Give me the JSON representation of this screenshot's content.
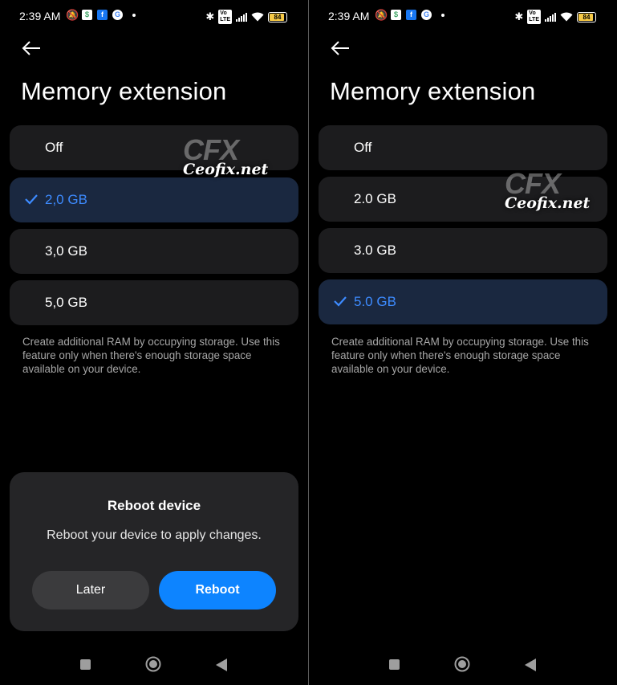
{
  "left": {
    "status": {
      "time": "2:39 AM",
      "battery": "84"
    },
    "title": "Memory extension",
    "options": [
      {
        "label": "Off",
        "selected": false
      },
      {
        "label": "2,0 GB",
        "selected": true
      },
      {
        "label": "3,0 GB",
        "selected": false
      },
      {
        "label": "5,0 GB",
        "selected": false
      }
    ],
    "description": "Create additional RAM by occupying storage. Use this feature only when there's enough storage space available on your device.",
    "dialog": {
      "title": "Reboot device",
      "message": "Reboot your device to apply changes.",
      "later_label": "Later",
      "reboot_label": "Reboot"
    },
    "watermark": {
      "logo": "CFX",
      "text": "Ceofix.net"
    }
  },
  "right": {
    "status": {
      "time": "2:39 AM",
      "battery": "84"
    },
    "title": "Memory extension",
    "options": [
      {
        "label": "Off",
        "selected": false
      },
      {
        "label": "2.0 GB",
        "selected": false
      },
      {
        "label": "3.0 GB",
        "selected": false
      },
      {
        "label": "5.0 GB",
        "selected": true
      }
    ],
    "description": "Create additional RAM by occupying storage. Use this feature only when there's enough storage space available on your device.",
    "watermark": {
      "logo": "CFX",
      "text": "Ceofix.net"
    }
  },
  "icons": {
    "back": "arrow-left-icon",
    "check": "check-icon",
    "nav_recents": "square-icon",
    "nav_home": "circle-icon",
    "nav_back": "triangle-icon"
  },
  "colors": {
    "accent": "#0d84ff",
    "selected_text": "#3d8bff",
    "selected_bg": "#1a2840",
    "card_bg": "#1c1c1e",
    "dialog_bg": "#252527"
  }
}
